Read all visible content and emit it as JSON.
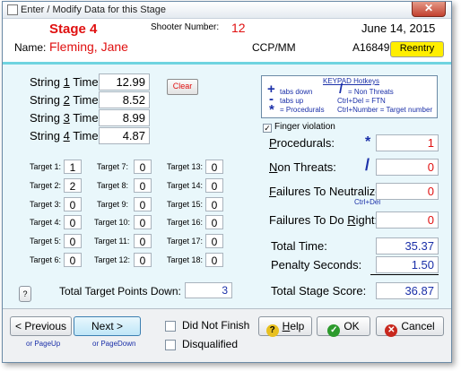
{
  "window": {
    "title": "Enter / Modify Data for this Stage"
  },
  "header": {
    "stage": "Stage  4",
    "shooter_number_label": "Shooter Number:",
    "shooter_number": "12",
    "date": "June 14, 2015",
    "name_label": "Name:",
    "name": "Fleming, Jane",
    "division": "CCP/MM",
    "member_id": "A16849",
    "reentry_label": "Reentry"
  },
  "strings": [
    {
      "label_pre": "String ",
      "num": "1",
      "label_post": " Time:",
      "value": "12.99"
    },
    {
      "label_pre": "String ",
      "num": "2",
      "label_post": " Time:",
      "value": "8.52"
    },
    {
      "label_pre": "String ",
      "num": "3",
      "label_post": " Time:",
      "value": "8.99"
    },
    {
      "label_pre": "String ",
      "num": "4",
      "label_post": " Time:",
      "value": "4.87"
    }
  ],
  "clear_label": "Clear",
  "targets": [
    {
      "label": "Target 1:",
      "value": "1"
    },
    {
      "label": "Target 2:",
      "value": "2"
    },
    {
      "label": "Target 3:",
      "value": "0"
    },
    {
      "label": "Target 4:",
      "value": "0"
    },
    {
      "label": "Target 5:",
      "value": "0"
    },
    {
      "label": "Target 6:",
      "value": "0"
    },
    {
      "label": "Target 7:",
      "value": "0"
    },
    {
      "label": "Target 8:",
      "value": "0"
    },
    {
      "label": "Target 9:",
      "value": "0"
    },
    {
      "label": "Target 10:",
      "value": "0"
    },
    {
      "label": "Target 11:",
      "value": "0"
    },
    {
      "label": "Target 12:",
      "value": "0"
    },
    {
      "label": "Target 13:",
      "value": "0"
    },
    {
      "label": "Target 14:",
      "value": "0"
    },
    {
      "label": "Target 15:",
      "value": "0"
    },
    {
      "label": "Target 16:",
      "value": "0"
    },
    {
      "label": "Target 17:",
      "value": "0"
    },
    {
      "label": "Target 18:",
      "value": "0"
    }
  ],
  "help_small_label": "?",
  "total_target_points_label": "Total Target Points Down:",
  "total_target_points": "3",
  "keypad": {
    "title": "KEYPAD Hotkeys",
    "plus_desc": "tabs down",
    "minus_desc": "tabs up",
    "star_desc": "= Procedurals",
    "slash_desc": "= Non Threats",
    "ctrl_del": "Ctrl+Del = FTN",
    "ctrl_num": "Ctrl+Number = Target number",
    "plus": "+",
    "minus": "-",
    "star": "*",
    "slash": "/"
  },
  "finger_violation": {
    "label": "Finger violation",
    "checked": true,
    "mark": "✓"
  },
  "procedurals": {
    "label": "Procedurals:",
    "u": "P",
    "rest": "rocedurals:",
    "key": "*",
    "value": "1"
  },
  "non_threats": {
    "u": "N",
    "rest": "on Threats:",
    "key": "/",
    "value": "0"
  },
  "ftn": {
    "u": "F",
    "rest": "ailures To Neutralize:",
    "value": "0",
    "hint": "Ctrl+Del"
  },
  "ftdr": {
    "pre": "Failures To Do ",
    "u": "R",
    "rest": "ight:",
    "value": "0"
  },
  "total_time": {
    "label": "Total Time:",
    "value": "35.37"
  },
  "penalty": {
    "label": "Penalty Seconds:",
    "value": "1.50"
  },
  "total_score": {
    "label": "Total Stage Score:",
    "value": "36.87"
  },
  "footer": {
    "previous": "< Previous",
    "next": "Next >",
    "prev_hint": "or PageUp",
    "next_hint": "or PageDown",
    "dnf": "Did Not Finish",
    "dq": "Disqualified",
    "help": "Help",
    "help_u": "H",
    "help_rest": "elp",
    "ok": "OK",
    "cancel": "Cancel"
  },
  "colors": {
    "accent_red": "#e01010",
    "value_blue": "#1a2fa8",
    "teal": "#6fd4e0",
    "reentry": "#ffee00"
  }
}
